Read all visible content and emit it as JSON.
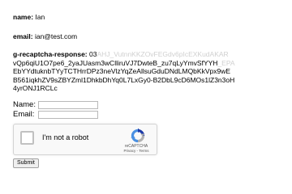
{
  "result": {
    "name_label": "name:",
    "name_value": "Ian",
    "email_label": "email:",
    "email_value": "ian@test.com",
    "token_label": "g-recaptcha-response:",
    "token_lines": [
      {
        "text": "03AHJ_VutnnKKZOvFEGdv6pIcEXKudAKAR",
        "faded": "AHJ_VutnnKKZOvFEGdv6pIcEXKudAKAR"
      },
      {
        "text": "vQp6qiU1O7pe6_2yaJUasm3wClliruVJ7DwteB_zu7qLyYmvSfYYH",
        "faded": "_EPA"
      },
      {
        "text": "EbYYdtuknbTYyTCTHrrDPz3neVlzYqZeAllsuGduDNdLMQbKkVpx9wE",
        "faded": ""
      },
      {
        "text": "B561iqkhZV9sZBYZml1DhkbDhYq0L7LxGy0-B2DbL9cD6MOs1lZ3n3oH",
        "faded": ""
      },
      {
        "text": "4yrONJ1RCLc",
        "faded": ""
      }
    ]
  },
  "form": {
    "name_label": "Name:",
    "name_value": "",
    "email_label": "Email:",
    "email_value": ""
  },
  "recaptcha": {
    "label": "I'm not a robot",
    "brand": "reCAPTCHA",
    "links": "Privacy - Terms"
  },
  "submit_label": "Submit",
  "colors": {
    "recaptcha_blue": "#4a90e2",
    "recaptcha_dark_blue": "#1c3aa9",
    "recaptcha_gray": "#b1b1b1"
  }
}
